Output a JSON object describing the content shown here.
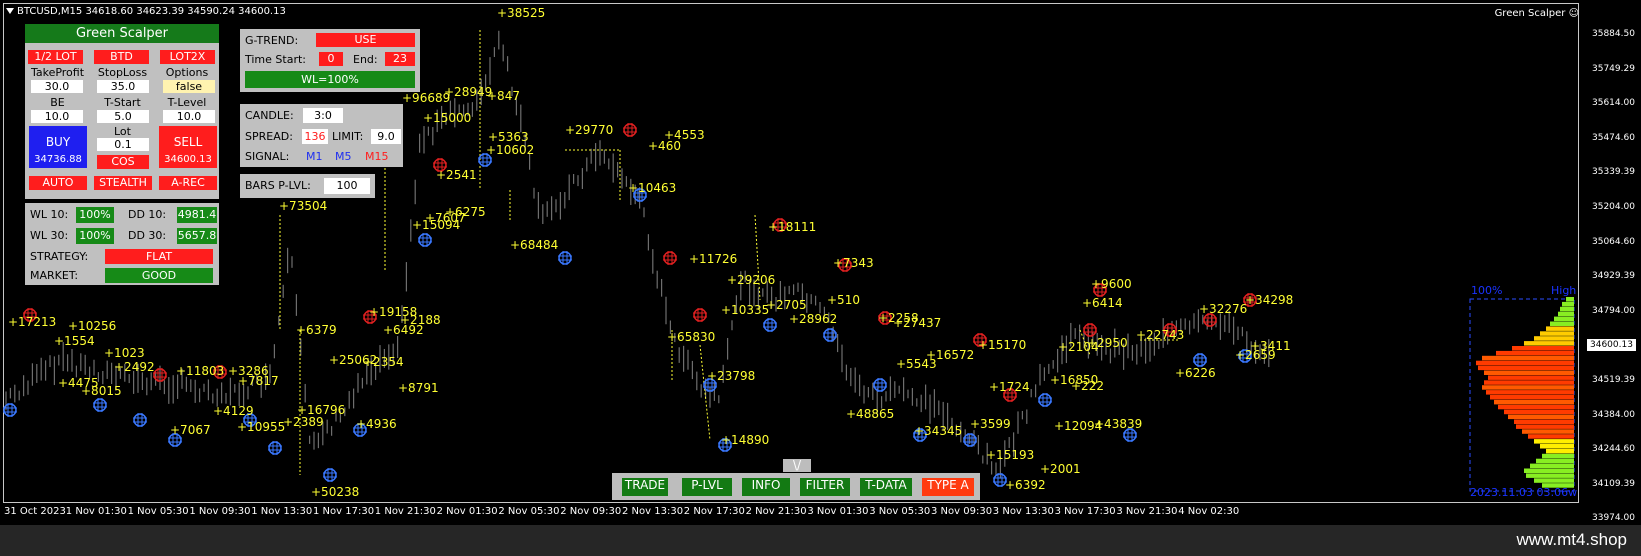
{
  "chart": {
    "symbol_line": "BTCUSD,M15  34618.60 34623.39 34590.24 34600.13",
    "indicator_name": "Green Scalper ☺",
    "current_price": "34600.13",
    "y_ticks": [
      "35884.50",
      "35749.29",
      "35614.00",
      "35474.60",
      "35339.39",
      "35204.00",
      "35064.60",
      "34929.39",
      "34794.00",
      "34654.60",
      "34519.39",
      "34384.00",
      "34244.60",
      "34109.39",
      "33974.00"
    ],
    "x_ticks": [
      "31 Oct 2023",
      "1 Nov 01:30",
      "1 Nov 05:30",
      "1 Nov 09:30",
      "1 Nov 13:30",
      "1 Nov 17:30",
      "1 Nov 21:30",
      "2 Nov 01:30",
      "2 Nov 05:30",
      "2 Nov 09:30",
      "2 Nov 13:30",
      "2 Nov 17:30",
      "2 Nov 21:30",
      "3 Nov 01:30",
      "3 Nov 05:30",
      "3 Nov 09:30",
      "3 Nov 13:30",
      "3 Nov 17:30",
      "3 Nov 21:30",
      "4 Nov 02:30"
    ],
    "profit_labels": [
      "+38525",
      "+96689",
      "+28949",
      "+847",
      "+15000",
      "+5363",
      "+10602",
      "+29770",
      "+460",
      "+4553",
      "+2541",
      "+6275",
      "+15094",
      "+7607",
      "+10463",
      "+73504",
      "+68484",
      "+11726",
      "+18111",
      "+29206",
      "+7343",
      "+2705",
      "+510",
      "+10335",
      "+28962",
      "+17213",
      "+10256",
      "+1554",
      "+1023",
      "+2492",
      "+11803",
      "+3286",
      "+4475",
      "+8015",
      "+7817",
      "+6379",
      "+19158",
      "+2188",
      "+6492",
      "+25062",
      "+2354",
      "+8791",
      "+4936",
      "+16796",
      "+2389",
      "+10955",
      "+7067",
      "+4129",
      "+65830",
      "+23798",
      "+14890",
      "+9600",
      "+6414",
      "+22743",
      "+32276",
      "+34298",
      "+3411",
      "+2659",
      "+6226",
      "+16572",
      "+15170",
      "+5543",
      "+48865",
      "+34345",
      "+1724",
      "+16850",
      "+222",
      "+43839",
      "+12094",
      "+3599",
      "+15193",
      "+6392",
      "+2001",
      "+2950",
      "+2104",
      "+27437",
      "+2258",
      "+50238"
    ],
    "profile_top_left": "100%",
    "profile_top_right": "High",
    "profile_bottom": "2023.11.03 03:06w"
  },
  "colors": {
    "background": "#000000",
    "panel": "#c0c0c0",
    "header_green": "#157a1a",
    "button_red": "#ff1d1d",
    "button_green": "#168a17",
    "profit_text": "#ffff33",
    "sell_marker": "#e02020",
    "buy_marker": "#3a78ff"
  },
  "main_panel": {
    "title": "Green Scalper",
    "lot_half": "1/2 LOT",
    "btd": "BTD",
    "lot2x": "LOT2X",
    "takeprofit_label": "TakeProfit",
    "stoploss_label": "StopLoss",
    "options_label": "Options",
    "takeprofit_value": "30.0",
    "stoploss_value": "35.0",
    "options_value": "false",
    "be_label": "BE",
    "tstart_label": "T-Start",
    "tlevel_label": "T-Level",
    "be_value": "10.0",
    "tstart_value": "5.0",
    "tlevel_value": "10.0",
    "lot_label": "Lot",
    "lot_value": "0.1",
    "buy_label": "BUY",
    "buy_price": "34736.88",
    "sell_label": "SELL",
    "sell_price": "34600.13",
    "cos": "COS",
    "auto": "AUTO",
    "stealth": "STEALTH",
    "arec": "A-REC"
  },
  "stats_panel": {
    "wl10_label": "WL 10:",
    "wl10_value": "100%",
    "dd10_label": "DD 10:",
    "dd10_value": "4981.4",
    "wl30_label": "WL 30:",
    "wl30_value": "100%",
    "dd30_label": "DD 30:",
    "dd30_value": "5657.8",
    "strategy_label": "STRATEGY:",
    "strategy_value": "FLAT",
    "market_label": "MARKET:",
    "market_value": "GOOD"
  },
  "trend_panel": {
    "gtrend_label": "G-TREND:",
    "gtrend_value": "USE",
    "timestart_label": "Time Start:",
    "timestart_value": "0",
    "end_label": "End:",
    "end_value": "23",
    "wl_value": "WL=100%"
  },
  "candle_panel": {
    "candle_label": "CANDLE:",
    "candle_value": "3:0",
    "spread_label": "SPREAD:",
    "spread_value": "136",
    "limit_label": "LIMIT:",
    "limit_value": "9.0",
    "signal_label": "SIGNAL:",
    "m1": "M1",
    "m5": "M5",
    "m15": "M15"
  },
  "bars_panel": {
    "label": "BARS P-LVL:",
    "value": "100"
  },
  "toolbar": {
    "tab": "\\/",
    "trade": "TRADE",
    "plvl": "P-LVL",
    "info": "INFO",
    "filter": "FILTER",
    "tdata": "T-DATA",
    "typea": "TYPE A"
  },
  "footer": {
    "watermark": "www.mt4.shop"
  }
}
